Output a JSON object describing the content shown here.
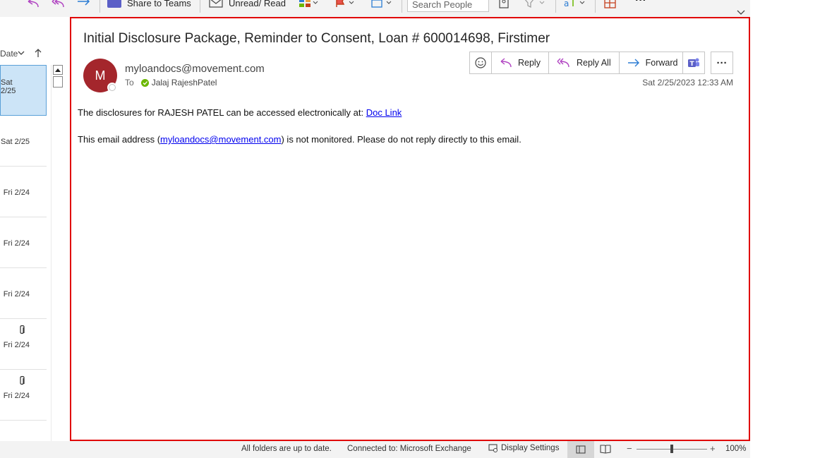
{
  "ribbon": {
    "share_to_teams_label": "Share to Teams",
    "unread_read_label": "Unread/ Read",
    "search_people_placeholder": "Search People",
    "more_label": "···"
  },
  "message_list": {
    "sort_label": "Date",
    "items": [
      {
        "date": "Sat 2/25",
        "selected": true,
        "attachment": false
      },
      {
        "date": "Sat 2/25",
        "selected": false,
        "attachment": false
      },
      {
        "date": "Fri 2/24",
        "selected": false,
        "attachment": false
      },
      {
        "date": "Fri 2/24",
        "selected": false,
        "attachment": false
      },
      {
        "date": "Fri 2/24",
        "selected": false,
        "attachment": false
      },
      {
        "date": "Fri 2/24",
        "selected": false,
        "attachment": true
      },
      {
        "date": "Fri 2/24",
        "selected": false,
        "attachment": true
      }
    ]
  },
  "email": {
    "subject": "Initial Disclosure Package, Reminder to Consent, Loan # 600014698, Firstimer",
    "avatar_initial": "M",
    "avatar_color": "#a4262c",
    "sender": "myloandocs@movement.com",
    "to_label": "To",
    "recipient": "Jalaj RajeshPatel",
    "sent_date": "Sat 2/25/2023 12:33 AM",
    "body_line1_prefix": "The disclosures for RAJESH PATEL can be accessed electronically at: ",
    "body_line1_link": "Doc Link",
    "body_line2_prefix": "This email address (",
    "body_line2_link": "myloandocs@movement.com",
    "body_line2_suffix": ") is not monitored. Please do not reply directly to this email."
  },
  "actions": {
    "reply": "Reply",
    "reply_all": "Reply All",
    "forward": "Forward",
    "more": "···"
  },
  "status_bar": {
    "sync_status": "All folders are up to date.",
    "connection": "Connected to: Microsoft Exchange",
    "display_settings": "Display Settings",
    "zoom_minus": "−",
    "zoom_plus": "+",
    "zoom_level": "100%"
  },
  "colors": {
    "selection_border": "#e00000",
    "selected_item_bg": "#cce4f7",
    "link": "#0000ee"
  }
}
